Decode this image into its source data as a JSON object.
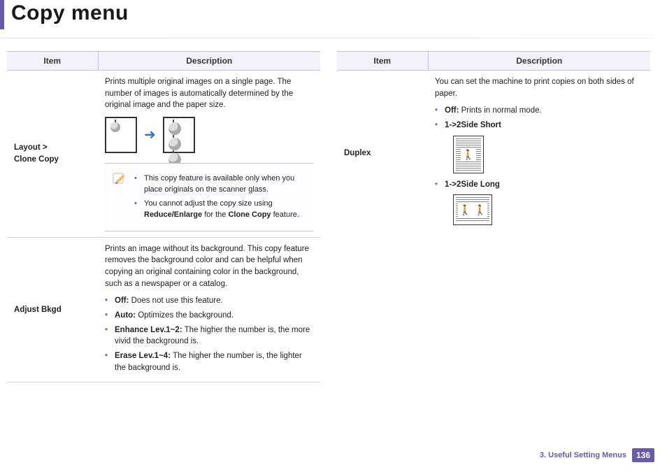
{
  "title": "Copy menu",
  "headers": {
    "item": "Item",
    "desc": "Description"
  },
  "left": {
    "clone": {
      "item1": "Layout >",
      "item2": "Clone Copy",
      "desc": "Prints multiple original images on a single page. The number of images is automatically determined by the original image and the paper size.",
      "note1": "This copy feature is available only when you place originals on the scanner glass.",
      "note2a": "You cannot adjust the copy size using ",
      "note2b": "Reduce/Enlarge",
      "note2c": " for the ",
      "note2d": "Clone Copy",
      "note2e": " feature."
    },
    "bkgd": {
      "item": "Adjust Bkgd",
      "desc": "Prints an image without its background. This copy feature removes the background color and can be helpful when copying an original containing color in the background, such as a newspaper or a catalog.",
      "off_l": "Off:",
      "off_t": " Does not use this feature.",
      "auto_l": "Auto:",
      "auto_t": " Optimizes the background.",
      "enh_l": "Enhance Lev.1~2:",
      "enh_t": " The higher the number is, the more vivid the background is.",
      "era_l": "Erase Lev.1~4:",
      "era_t": " The higher the number is, the lighter the background is."
    }
  },
  "right": {
    "duplex": {
      "item": "Duplex",
      "desc": "You can set the machine to print copies on both sides of paper.",
      "off_l": "Off:",
      "off_t": " Prints in normal mode.",
      "short": "1->2Side Short",
      "long": "1->2Side Long"
    }
  },
  "footer": {
    "chapter": "3.  Useful Setting Menus",
    "page": "136"
  }
}
